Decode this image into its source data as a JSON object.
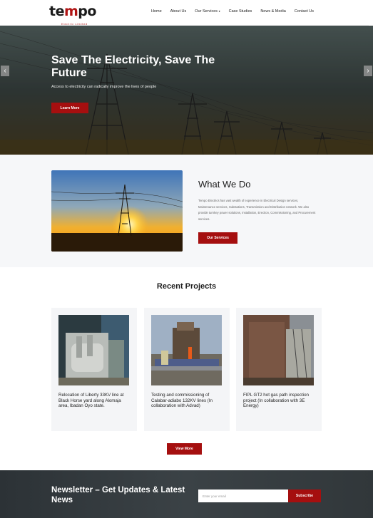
{
  "header": {
    "logo_main": "tempo",
    "logo_tagline": "Electric Limited",
    "nav": [
      "Home",
      "About Us",
      "Our Services",
      "Case Studies",
      "News & Media",
      "Contact Us"
    ],
    "services_caret": "▾"
  },
  "hero": {
    "title": "Save The Electricity, Save The Future",
    "subtitle": "Access to electricity can radically improve the lives of people",
    "button": "Learn More",
    "prev_arrow": "‹",
    "next_arrow": "›"
  },
  "what_we_do": {
    "title": "What We Do",
    "text": "Tempo Electrics has vast wealth of experience in Electrical Design services, Maintenance services, Substations, Transmission and Distribution network. We also provide turnkey power solutions, Installation, Erection, Commissioning, and Procurement services.",
    "button": "Our Services"
  },
  "projects": {
    "title": "Recent Projects",
    "items": [
      {
        "caption": "Relocation of Liberty 33KV line at Black Horse yard along Alomaja area, Ibadan Oyo state."
      },
      {
        "caption": "Testing and commissioning of Calabar-adiabo 132KV lines (In collaboration with Advad)"
      },
      {
        "caption": "FIPL GT2 hot gas path inspection project (In collaboration with 3E Energy)"
      }
    ],
    "button": "View More"
  },
  "newsletter": {
    "title": "Newsletter – Get Updates & Latest News",
    "placeholder": "Enter your email",
    "button": "Subscribe"
  },
  "colors": {
    "accent": "#a50f0f",
    "dark": "#2c3236"
  }
}
